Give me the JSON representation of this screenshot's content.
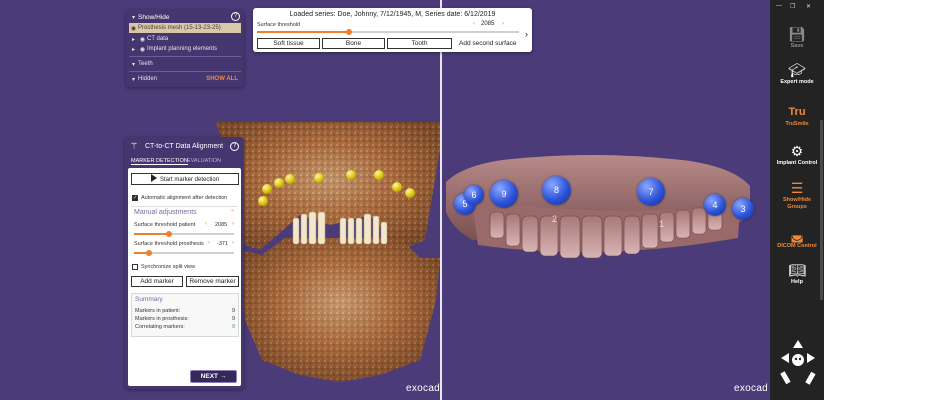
{
  "show_hide": {
    "title": "Show/Hide",
    "help": "?",
    "items": [
      {
        "label": "Prosthesis mesh (15-13-23-25)",
        "selected": true
      },
      {
        "label": "CT data"
      },
      {
        "label": "Implant planning elements"
      },
      {
        "label": "Teeth"
      },
      {
        "label": "Hidden"
      }
    ],
    "show_all": "SHOW ALL"
  },
  "top_bar": {
    "title": "Loaded series: Doe, Johnny, 7/12/1945, M, Series date: 6/12/2019",
    "threshold_label": "Surface threshold",
    "threshold_value": "2085",
    "threshold_fraction": 0.35,
    "buttons": [
      "Soft tissue",
      "Bone",
      "Tooth"
    ],
    "add_surface": "Add second surface"
  },
  "ct_panel": {
    "title": "CT-to-CT Data Alignment",
    "help": "?",
    "tabs": [
      "MARKER DETECTION",
      "EVALUATION"
    ],
    "start_button": "Start marker detection",
    "auto_align_label": "Automatic alignment after detection",
    "auto_align_checked": true,
    "section_title": "Manual adjustments",
    "sliders": [
      {
        "label": "Surface threshold patient",
        "value": "2085",
        "fraction": 0.35
      },
      {
        "label": "Surface threshold prosthesis",
        "value": "-371",
        "fraction": 0.15
      }
    ],
    "sync_label": "Synchronize split view",
    "sync_checked": false,
    "add_marker": "Add marker",
    "remove_marker": "Remove marker",
    "summary": {
      "title": "Summary",
      "rows": [
        {
          "label": "Markers in patient:",
          "value": "9",
          "color": "#333333"
        },
        {
          "label": "Markers in prosthesis:",
          "value": "9",
          "color": "#333333"
        },
        {
          "label": "Correlating markers:",
          "value": "9",
          "color": "#3aa845"
        }
      ]
    },
    "back": "BACK",
    "next": "NEXT"
  },
  "sidebar": {
    "items": [
      {
        "label": "Save",
        "icon": "save-icon",
        "color": "#8a8a8a"
      },
      {
        "label": "Expert mode",
        "icon": "graduation-cap-icon",
        "color": "#ffffff"
      },
      {
        "label": "TruSmile",
        "icon": "trusmile-icon",
        "color": "#f08a3a"
      },
      {
        "label": "Implant Control",
        "icon": "implant-icon",
        "color": "#ffffff"
      },
      {
        "label": "Show/Hide Groups",
        "icon": "groups-icon",
        "color": "#f08a3a"
      },
      {
        "label": "DICOM Control",
        "icon": "dicom-icon",
        "color": "#f08a3a"
      },
      {
        "label": "Help",
        "icon": "help-book-icon",
        "color": "#ffffff"
      }
    ],
    "trusmile_text": "Tru"
  },
  "viewports": {
    "left_watermark": "exocad",
    "right_watermark": "exocad",
    "prosthesis_markers": [
      "5",
      "6",
      "9",
      "8",
      "7",
      "4",
      "3"
    ],
    "jaw_numbers": [
      "2",
      "1"
    ]
  },
  "colors": {
    "accent": "#ee7f2d",
    "panel": "#45366f",
    "viewport": "#4b3b79",
    "marker_blue": "#2d52d8",
    "marker_yellow": "#d6c20a"
  }
}
